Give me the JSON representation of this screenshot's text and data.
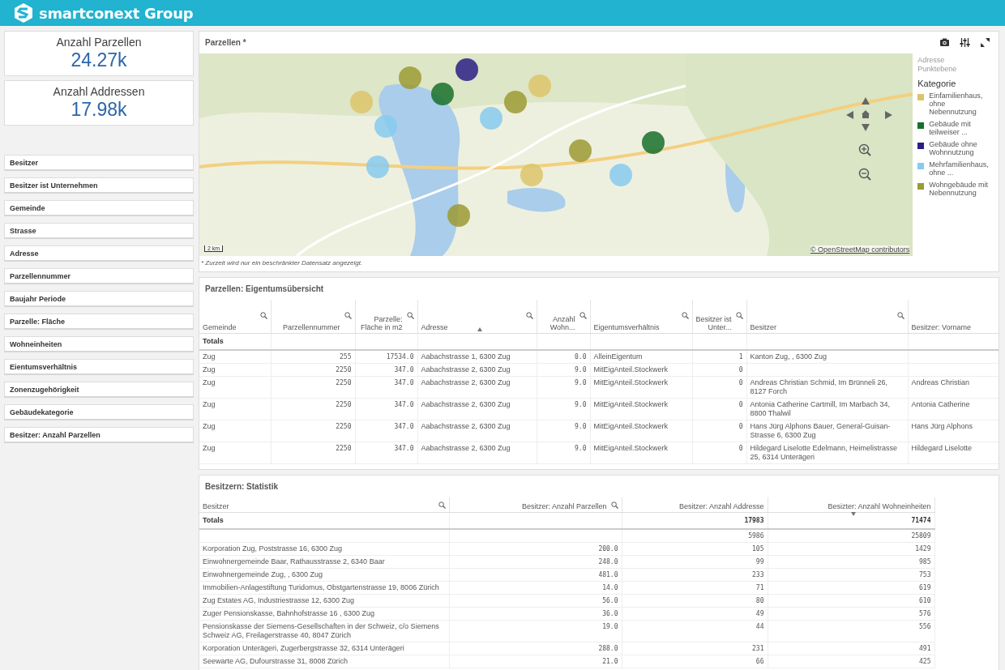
{
  "header": {
    "brand": "smartconext Group"
  },
  "kpis": [
    {
      "label": "Anzahl Parzellen",
      "value": "24.27k"
    },
    {
      "label": "Anzahl Addressen",
      "value": "17.98k"
    }
  ],
  "filters": [
    "Besitzer",
    "Besitzer ist Unternehmen",
    "Gemeinde",
    "Strasse",
    "Adresse",
    "Parzellennummer",
    "Baujahr Periode",
    "Parzelle: Fläche",
    "Wohneinheiten",
    "Eientumsverhältnis",
    "Zonenzugehörigkeit",
    "Gebäudekategorie",
    "Besitzer: Anzahl Parzellen"
  ],
  "map_panel": {
    "title": "Parzellen *",
    "tools": [
      {
        "kind": "camera"
      },
      {
        "kind": "settings"
      },
      {
        "kind": "expand"
      }
    ],
    "legend": {
      "subtitles": [
        "Adresse",
        "Punktebene"
      ],
      "title": "Kategorie",
      "items": [
        {
          "label": "Einfamilienhaus, ohne Nebennutzung",
          "color": "#dcc46a"
        },
        {
          "label": "Gebäude mit teilweiser ...",
          "color": "#17702c"
        },
        {
          "label": "Gebäude ohne Wohnnutzung",
          "color": "#2b1f86"
        },
        {
          "label": "Mehrfamilienhaus, ohne ...",
          "color": "#86caee"
        },
        {
          "label": "Wohngebäude mit Nebennutzung",
          "color": "#9c9a34"
        }
      ]
    },
    "scale": "2 km",
    "attribution": "© OpenStreetMap contributors",
    "footnote": "* Zurzeit wird nur ein beschränkter Datensatz angezeigt."
  },
  "tables": [
    {
      "title": "Parzellen: Eigentumsübersicht",
      "columns": [
        {
          "label": "Gemeinde",
          "kind": "text",
          "search": true
        },
        {
          "label": "Parzellennummer",
          "kind": "number",
          "search": true
        },
        {
          "label": "Parzelle: Fläche in m2",
          "kind": "number",
          "search": true
        },
        {
          "label": "Adresse",
          "kind": "text",
          "search": true,
          "sort_up": true
        },
        {
          "label": "Anzahl Wohn...",
          "kind": "number",
          "search": true
        },
        {
          "label": "Eigentumsverhältnis",
          "kind": "text",
          "search": true
        },
        {
          "label": "Besitzer ist Unter...",
          "kind": "number",
          "search": true
        },
        {
          "label": "Besitzer",
          "kind": "text",
          "search": true
        },
        {
          "label": "Besitzer: Vorname",
          "kind": "text",
          "search": false
        }
      ],
      "totals": {
        "label": "Totals"
      },
      "rows": [
        [
          "Zug",
          "255",
          "17534.0",
          "Aabachstrasse 1, 6300 Zug",
          "0.0",
          "AlleinEigentum",
          "1",
          "Kanton Zug, , 6300 Zug",
          null
        ],
        [
          "Zug",
          "2250",
          "347.0",
          "Aabachstrasse 2, 6300 Zug",
          "9.0",
          "MitEigAnteil.Stockwerk",
          "0",
          null,
          null
        ],
        [
          "Zug",
          "2250",
          "347.0",
          "Aabachstrasse 2, 6300 Zug",
          "9.0",
          "MitEigAnteil.Stockwerk",
          "0",
          "Andreas Christian Schmid, Im Brünneli 26, 8127 Forch",
          "Andreas Christian"
        ],
        [
          "Zug",
          "2250",
          "347.0",
          "Aabachstrasse 2, 6300 Zug",
          "9.0",
          "MitEigAnteil.Stockwerk",
          "0",
          "Antonia Catherine Cartmill, Im Marbach 34, 8800 Thalwil",
          "Antonia Catherine"
        ],
        [
          "Zug",
          "2250",
          "347.0",
          "Aabachstrasse 2, 6300 Zug",
          "9.0",
          "MitEigAnteil.Stockwerk",
          "0",
          "Hans Jürg Alphons Bauer, General-Guisan-Strasse 6, 6300 Zug",
          "Hans Jürg Alphons"
        ],
        [
          "Zug",
          "2250",
          "347.0",
          "Aabachstrasse 2, 6300 Zug",
          "9.0",
          "MitEigAnteil.Stockwerk",
          "0",
          "Hildegard Liselotte Edelmann, Heimelistrasse 25, 6314 Unterägeri",
          "Hildegard Liselotte"
        ]
      ]
    },
    {
      "title": "Besitzern: Statistik",
      "columns": [
        {
          "label": "Besitzer",
          "kind": "text",
          "search": true
        },
        {
          "label": "Besitzer: Anzahl Parzellen",
          "kind": "number",
          "search": true
        },
        {
          "label": "Besitzer: Anzahl Addresse",
          "kind": "number",
          "search": false
        },
        {
          "label": "Besizter: Anzahl Wohneinheiten",
          "kind": "number",
          "search": false,
          "sort_down": true
        }
      ],
      "totals": {
        "label": "Totals",
        "cells": [
          null,
          "17983",
          "71474"
        ]
      },
      "rows": [
        [
          null,
          null,
          "5986",
          "25809"
        ],
        [
          "Korporation Zug, Poststrasse 16, 6300 Zug",
          "200.0",
          "105",
          "1429"
        ],
        [
          "Einwohnergemeinde Baar, Rathausstrasse 2, 6340 Baar",
          "248.0",
          "99",
          "985"
        ],
        [
          "Einwohnergemeinde Zug, , 6300 Zug",
          "481.0",
          "233",
          "753"
        ],
        [
          "Immobilien-Anlagestiftung Turidomus, Obstgartenstrasse 19, 8006 Zürich",
          "14.0",
          "71",
          "619"
        ],
        [
          "Zug Estates AG, Industriestrasse 12, 6300 Zug",
          "56.0",
          "80",
          "610"
        ],
        [
          "Zuger Pensionskasse, Bahnhofstrasse 16 , 6300 Zug",
          "36.0",
          "49",
          "576"
        ],
        [
          "Pensionskasse der Siemens-Gesellschaften in der Schweiz, c/o Siemens Schweiz AG, Freilagerstrasse 40, 8047 Zürich",
          "19.0",
          "44",
          "556"
        ],
        [
          "Korporation Unterägeri, Zugerbergstrasse 32, 6314 Unterägeri",
          "288.0",
          "231",
          "491"
        ],
        [
          "Seewarte AG, Dufourstrasse 31, 8008 Zürich",
          "21.0",
          "66",
          "425"
        ]
      ]
    }
  ]
}
